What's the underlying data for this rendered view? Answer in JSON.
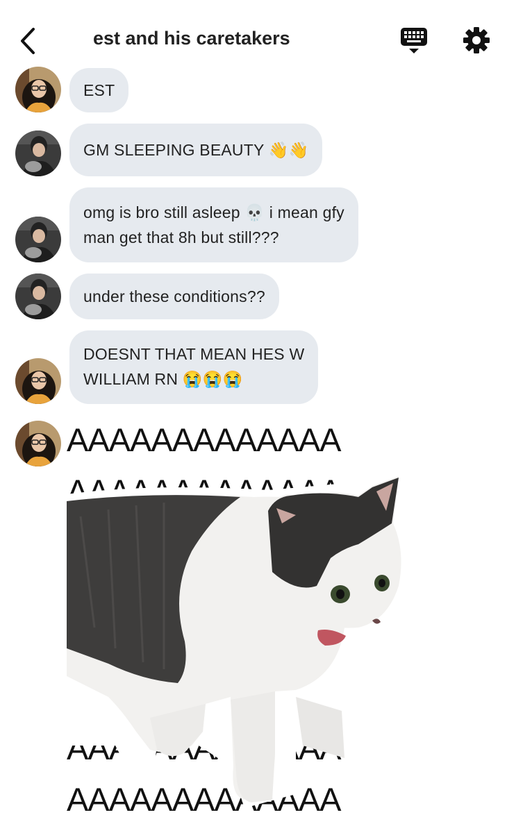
{
  "header": {
    "title": "est and his caretakers",
    "back_icon": "chevron-left-icon",
    "keyboard_icon": "keyboard-icon",
    "settings_icon": "gear-icon"
  },
  "messages": [
    {
      "sender_avatar": "avatar-girl-glasses",
      "lines": [
        "EST"
      ]
    },
    {
      "sender_avatar": "avatar-guy-cat",
      "lines": [
        "GM SLEEPING BEAUTY 👋👋"
      ]
    },
    {
      "sender_avatar": "avatar-guy-cat",
      "lines": [
        "omg is bro still asleep 💀 i mean gfy",
        "man get that 8h but still???"
      ]
    },
    {
      "sender_avatar": "avatar-guy-cat",
      "lines": [
        "under these conditions??"
      ]
    },
    {
      "sender_avatar": "avatar-girl-glasses",
      "lines": [
        "DOESNT THAT MEAN HES W",
        "WILLIAM RN 😭😭😭"
      ]
    }
  ],
  "sticker": {
    "sender_avatar": "avatar-girl-glasses",
    "a_text": "AAAAAAAAAAAAA",
    "subject": "screaming-cat-sticker"
  },
  "colors": {
    "bubble": "#e6eaef",
    "text": "#222222",
    "background": "#ffffff"
  }
}
